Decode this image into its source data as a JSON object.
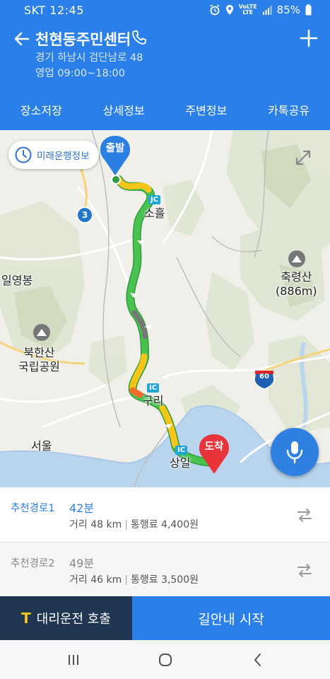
{
  "status_bar": {
    "carrier_time": "SKT 12:45",
    "volte_top": "VoLTE",
    "lte": "LTE",
    "battery": "85%"
  },
  "header": {
    "title": "천현동주민센터",
    "address": "경기 하남시 검단남로 48",
    "hours": "영업 09:00~18:00"
  },
  "tabs": [
    {
      "label": "장소저장"
    },
    {
      "label": "상세정보"
    },
    {
      "label": "주변정보"
    },
    {
      "label": "카톡공유"
    }
  ],
  "map": {
    "future_button": "미래운행정보",
    "start_pin": "출발",
    "end_pin": "도착",
    "labels": {
      "sohul": "소흘",
      "ilyeongbong": "일영봉",
      "chungnyeongsan": "축령산",
      "chungnyeongsan_height": "(886m)",
      "bukhansan": "북한산",
      "bukhansan_sub": "국립공원",
      "guri": "구리",
      "seoul": "서울",
      "sangil": "상일"
    },
    "badges": {
      "jc": "JC",
      "ic1": "IC",
      "ic2": "IC",
      "route3": "3",
      "route60": "60"
    }
  },
  "routes": [
    {
      "name": "추천경로1",
      "time": "42분",
      "distance": "거리 48 km",
      "toll": "통행료 4,400원",
      "selected": true
    },
    {
      "name": "추천경로2",
      "time": "49분",
      "distance": "거리 46 km",
      "toll": "통행료 3,500원",
      "selected": false
    }
  ],
  "bottom": {
    "driver_button": "대리운전 호출",
    "driver_mark": "T",
    "start_button": "길안내 시작"
  },
  "colors": {
    "primary": "#2a80e8",
    "dark_button": "#1f3552",
    "route_green": "#3bb84a",
    "route_yellow": "#f5c518",
    "pin_blue": "#2a7fe0",
    "pin_red": "#e8343a"
  }
}
